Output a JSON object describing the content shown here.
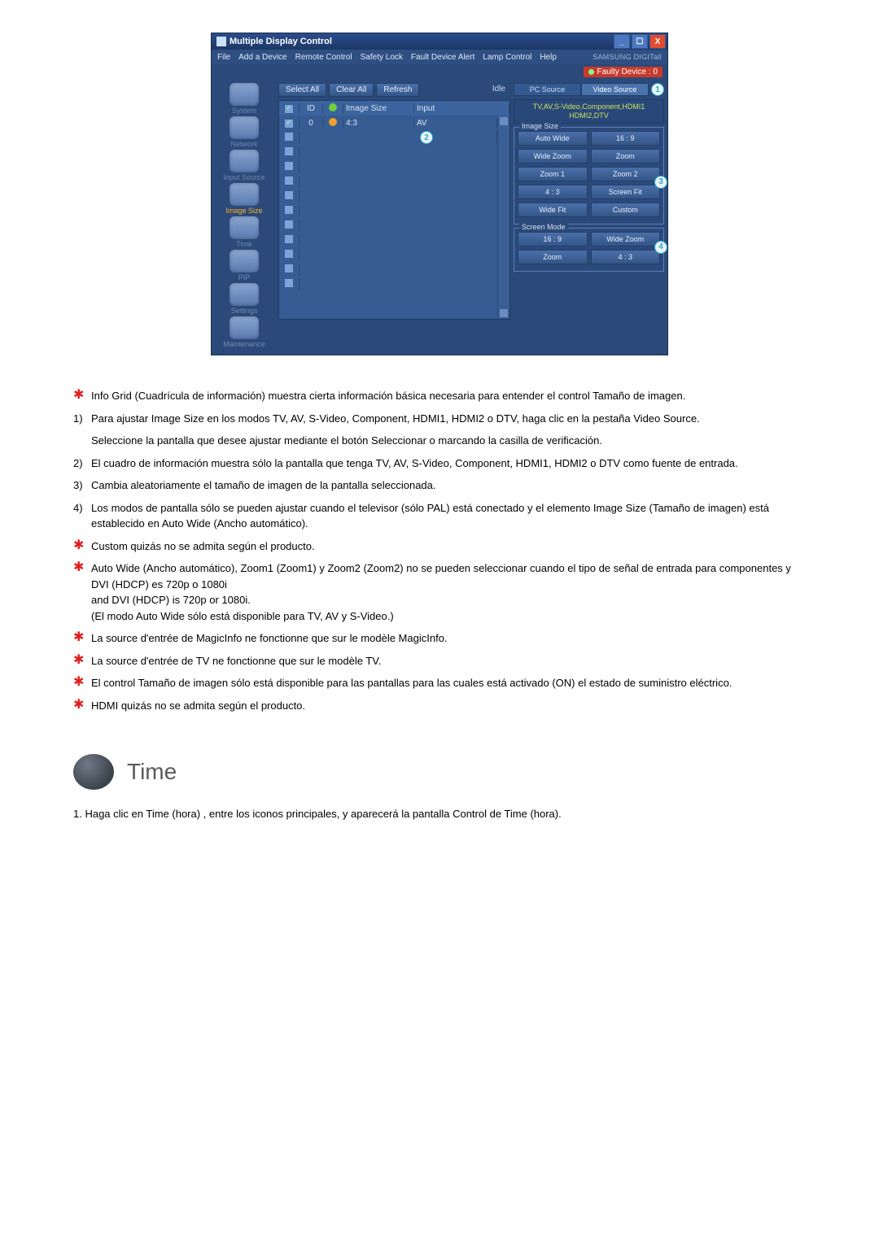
{
  "window": {
    "title": "Multiple Display Control",
    "menu": [
      "File",
      "Add a Device",
      "Remote Control",
      "Safety Lock",
      "Fault Device Alert",
      "Lamp Control",
      "Help"
    ],
    "brand": "SAMSUNG DIGITall",
    "faulty_label": "Faulty Device : 0",
    "toolbar": {
      "select_all": "Select All",
      "clear_all": "Clear All",
      "refresh": "Refresh",
      "idle": "Idle"
    },
    "grid": {
      "headers": {
        "id": "ID",
        "image_size": "Image Size",
        "input": "Input"
      },
      "rows": [
        {
          "checked": true,
          "id": "0",
          "status": "orange",
          "image_size": "4:3",
          "input": "AV"
        }
      ],
      "blank_rows": 10,
      "badge2": "2"
    },
    "sidebar": [
      "System",
      "Network",
      "Input Source",
      "Image Size",
      "Time",
      "PIP",
      "Settings",
      "Maintenance"
    ],
    "sidebar_active_index": 3,
    "right": {
      "tab_pc": "PC Source",
      "tab_video": "Video Source",
      "badge1": "1",
      "src_line1": "TV,AV,S-Video,Component,HDMI1",
      "src_line2": "HDMI2,DTV",
      "imgsize_legend": "Image Size",
      "badge3": "3",
      "imgsize_opts": [
        "Auto Wide",
        "16 : 9",
        "Wide Zoom",
        "Zoom",
        "Zoom 1",
        "Zoom 2",
        "4 : 3",
        "Screen Fit",
        "Wide Fit",
        "Custom"
      ],
      "scrmode_legend": "Screen Mode",
      "badge4": "4",
      "scrmode_opts": [
        "16 : 9",
        "Wide Zoom",
        "Zoom",
        "4 : 3"
      ]
    }
  },
  "notes": {
    "n0": "Info Grid (Cuadrícula de información) muestra cierta información básica necesaria para entender el control Tamaño de imagen.",
    "n1a": "Para ajustar Image Size en los modos TV, AV, S-Video, Component, HDMI1, HDMI2 o DTV, haga clic en la pestaña Video Source.",
    "n1b": "Seleccione la pantalla que desee ajustar mediante el botón Seleccionar o marcando la casilla de verificación.",
    "n2": "El cuadro de información muestra sólo la pantalla que tenga TV, AV, S-Video, Component, HDMI1, HDMI2 o DTV como fuente de entrada.",
    "n3": "Cambia aleatoriamente el tamaño de imagen de la pantalla seleccionada.",
    "n4": "Los modos de pantalla sólo se pueden ajustar cuando el televisor (sólo PAL) está conectado y el elemento Image Size (Tamaño de imagen) está establecido en Auto Wide (Ancho automático).",
    "s1": "Custom quizás no se admita según el producto.",
    "s2a": "Auto Wide (Ancho automático), Zoom1 (Zoom1) y Zoom2 (Zoom2) no se pueden seleccionar cuando el tipo de señal de entrada para componentes y DVI (HDCP) es 720p o 1080i",
    "s2b": "and DVI (HDCP) is 720p or 1080i.",
    "s2c": "(El modo Auto Wide sólo está disponible para TV, AV y S-Video.)",
    "s3": "La source d'entrée de MagicInfo ne fonctionne que sur le modèle MagicInfo.",
    "s4": "La source d'entrée de TV ne fonctionne que sur le modèle TV.",
    "s5": "El control Tamaño de imagen sólo está disponible para las pantallas para las cuales está activado (ON) el estado de suministro eléctrico.",
    "s6": "HDMI quizás no se admita según el producto."
  },
  "labels": {
    "num1": "1)",
    "num2": "2)",
    "num3": "3)",
    "num4": "4)"
  },
  "section": {
    "title": "Time",
    "line1": "1.  Haga clic en Time (hora) , entre los iconos principales, y aparecerá la pantalla Control de Time (hora)."
  }
}
